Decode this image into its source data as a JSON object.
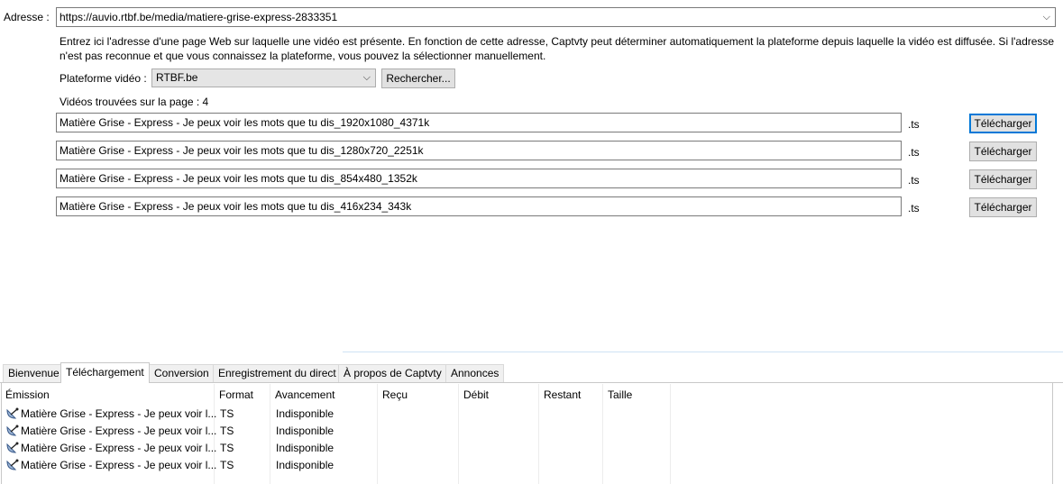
{
  "address": {
    "label": "Adresse :",
    "value": "https://auvio.rtbf.be/media/matiere-grise-express-2833351"
  },
  "help_text_line1": "Entrez ici l'adresse d'une page Web sur laquelle une vidéo est présente. En fonction de cette adresse, Captvty peut déterminer automatiquement la plateforme depuis laquelle la vidéo est diffusée. Si l'adresse",
  "help_text_line2": "n'est pas reconnue et que vous connaissez la plateforme, vous pouvez la sélectionner manuellement.",
  "platform": {
    "label": "Plateforme vidéo :",
    "selected": "RTBF.be",
    "search_button": "Rechercher..."
  },
  "videos_found": "Vidéos trouvées sur la page : 4",
  "videos": [
    {
      "name": "Matière Grise - Express - Je peux voir les mots que tu dis_1920x1080_4371k",
      "ext": ".ts",
      "button": "Télécharger"
    },
    {
      "name": "Matière Grise - Express - Je peux voir les mots que tu dis_1280x720_2251k",
      "ext": ".ts",
      "button": "Télécharger"
    },
    {
      "name": "Matière Grise - Express - Je peux voir les mots que tu dis_854x480_1352k",
      "ext": ".ts",
      "button": "Télécharger"
    },
    {
      "name": "Matière Grise - Express - Je peux voir les mots que tu dis_416x234_343k",
      "ext": ".ts",
      "button": "Télécharger"
    }
  ],
  "tabs": [
    "Bienvenue",
    "Téléchargement",
    "Conversion",
    "Enregistrement du direct",
    "À propos de Captvty",
    "Annonces"
  ],
  "active_tab": "Téléchargement",
  "columns": [
    "Émission",
    "Format",
    "Avancement",
    "Reçu",
    "Débit",
    "Restant",
    "Taille"
  ],
  "downloads": [
    {
      "emission": "Matière Grise - Express - Je peux voir l...",
      "format": "TS",
      "status": "Indisponible"
    },
    {
      "emission": "Matière Grise - Express - Je peux voir l...",
      "format": "TS",
      "status": "Indisponible"
    },
    {
      "emission": "Matière Grise - Express - Je peux voir l...",
      "format": "TS",
      "status": "Indisponible"
    },
    {
      "emission": "Matière Grise - Express - Je peux voir l...",
      "format": "TS",
      "status": "Indisponible"
    }
  ],
  "icons": {
    "download_row": "satellite-dish-icon",
    "dropdown": "chevron-down-icon"
  },
  "colors": {
    "focus_border": "#0078d7",
    "divider": "#cfe3f5"
  }
}
